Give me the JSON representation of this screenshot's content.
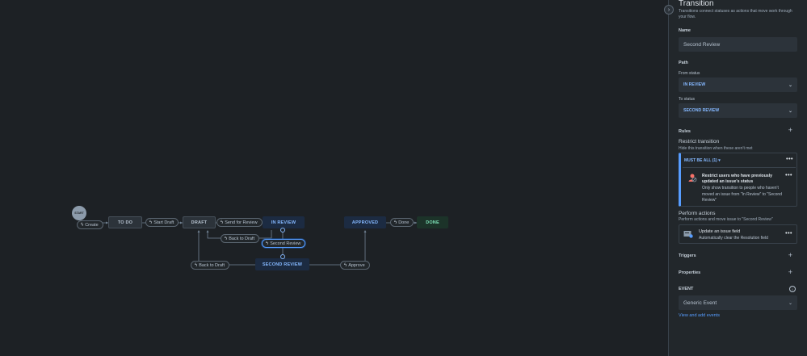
{
  "diagram": {
    "start_label": "START",
    "statuses": {
      "todo": "TO DO",
      "draft": "DRAFT",
      "in_review": "IN REVIEW",
      "approved": "APPROVED",
      "done": "DONE",
      "second_review": "SECOND REVIEW"
    },
    "transitions": {
      "create": "Create",
      "start_draft": "Start Draft",
      "send_for_review": "Send for Review",
      "back_to_draft_1": "Back to Draft",
      "second_review": "Second Review",
      "back_to_draft_2": "Back to Draft",
      "approve": "Approve",
      "done": "Done"
    }
  },
  "panel": {
    "title": "Transition",
    "subtitle": "Transitions connect statuses as actions that move work through your flow.",
    "name_label": "Name",
    "name_value": "Second Review",
    "path_label": "Path",
    "from_label": "From status",
    "from_value": "IN REVIEW",
    "to_label": "To status",
    "to_value": "SECOND REVIEW",
    "rules_label": "Rules",
    "restrict_title": "Restrict transition",
    "restrict_sub": "Hide this transition when these aren't met",
    "must_label": "MUST BE ALL (1)",
    "rule_title": "Restrict users who have previously updated an issue's status",
    "rule_desc": "Only show transition to people who haven't moved an issue from \"In Review\" to \"Second Review\"",
    "perform_title": "Perform actions",
    "perform_sub": "Perform actions and move issue to \"Second Review\"",
    "action_title": "Update an issue field",
    "action_sub": "Automatically clear the Resolution field",
    "triggers_label": "Triggers",
    "properties_label": "Properties",
    "event_label": "EVENT",
    "event_value": "Generic Event",
    "events_link": "View and add events"
  },
  "colors": {
    "background": "#1d2125",
    "panel": "#22272b",
    "accent": "#579dff",
    "status_in_progress": "#1c2b42",
    "status_done": "#1c3329"
  },
  "icons": [
    "lightning-icon",
    "chevron-down-icon",
    "chevron-right-icon",
    "plus-icon",
    "more-icon",
    "info-icon",
    "restrict-user-icon",
    "update-field-icon"
  ]
}
